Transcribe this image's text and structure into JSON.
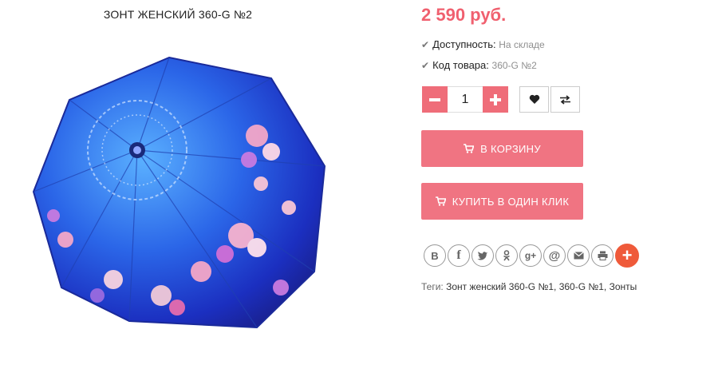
{
  "product": {
    "title": "ЗОНТ ЖЕНСКИЙ 360-G №2",
    "price": "2 590 руб.",
    "availability_label": "Доступность:",
    "availability_value": "На складе",
    "sku_label": "Код товара:",
    "sku_value": "360-G №2"
  },
  "quantity": {
    "minus_icon": "minus-icon",
    "value": "1",
    "plus_icon": "plus-icon"
  },
  "actions": {
    "wishlist_icon": "heart-icon",
    "compare_icon": "compare-arrows-icon",
    "cart_label": "В КОРЗИНУ",
    "one_click_label": "КУПИТЬ В ОДИН КЛИК"
  },
  "share": {
    "items": [
      "vk",
      "facebook",
      "twitter",
      "odnoklassniki",
      "google-plus",
      "email-at",
      "mail",
      "print",
      "more"
    ],
    "vk_text": "В",
    "fb_text": "f",
    "gplus_text": "g+",
    "at_text": "@",
    "more_text": "+"
  },
  "tags": {
    "label": "Теги:",
    "values": "Зонт женский 360-G №1, 360-G №1, Зонты"
  },
  "colors": {
    "accent": "#f07482",
    "price": "#f0606f",
    "share_more": "#ef5a3a"
  }
}
